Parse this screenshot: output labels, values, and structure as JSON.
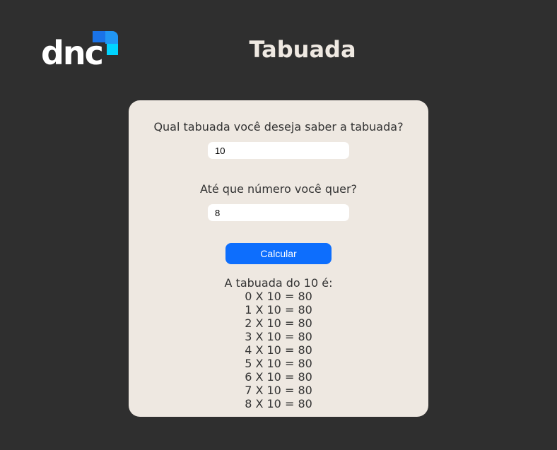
{
  "brand": {
    "logo_text": "dnc",
    "colors": {
      "mark_dark_blue": "#1a73e8",
      "mark_light_blue": "#2196f3",
      "mark_cyan": "#00d4ff"
    }
  },
  "header": {
    "title": "Tabuada"
  },
  "form": {
    "table_question": "Qual tabuada você deseja saber a tabuada?",
    "table_value": "10",
    "limit_question": "Até que número você quer?",
    "limit_value": "8",
    "submit_label": "Calcular",
    "submit_color": "#0d6efd"
  },
  "result": {
    "heading": "A tabuada do 10 é:",
    "rows": [
      "0 X 10 = 80",
      "1 X 10 = 80",
      "2 X 10 = 80",
      "3 X 10 = 80",
      "4 X 10 = 80",
      "5 X 10 = 80",
      "6 X 10 = 80",
      "7 X 10 = 80",
      "8 X 10 = 80"
    ]
  }
}
